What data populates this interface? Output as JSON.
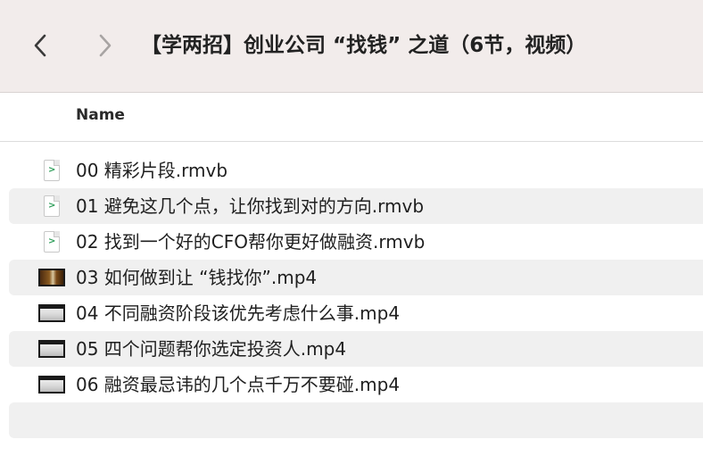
{
  "window": {
    "title": "【学两招】创业公司 “找钱” 之道（6节，视频）"
  },
  "navigation": {
    "back_icon": "chevron-left-icon",
    "forward_icon": "chevron-right-icon"
  },
  "columns": {
    "name_label": "Name"
  },
  "files": [
    {
      "name": "00 精彩片段.rmvb",
      "icon": "rmvb-document-icon"
    },
    {
      "name": "01 避免这几个点，让你找到对的方向.rmvb",
      "icon": "rmvb-document-icon"
    },
    {
      "name": "02 找到一个好的CFO帮你更好做融资.rmvb",
      "icon": "rmvb-document-icon"
    },
    {
      "name": "03 如何做到让 “钱找你”.mp4",
      "icon": "video-thumbnail-icon"
    },
    {
      "name": "04 不同融资阶段该优先考虑什么事.mp4",
      "icon": "video-thumbnail-icon"
    },
    {
      "name": "05 四个问题帮你选定投资人.mp4",
      "icon": "video-thumbnail-icon"
    },
    {
      "name": "06 融资最忌讳的几个点千万不要碰.mp4",
      "icon": "video-thumbnail-icon"
    }
  ],
  "colors": {
    "toolbar_bg": "#f2eceb",
    "row_stripe": "#f0f0f0",
    "rmvb_accent": "#2e9e5a"
  }
}
